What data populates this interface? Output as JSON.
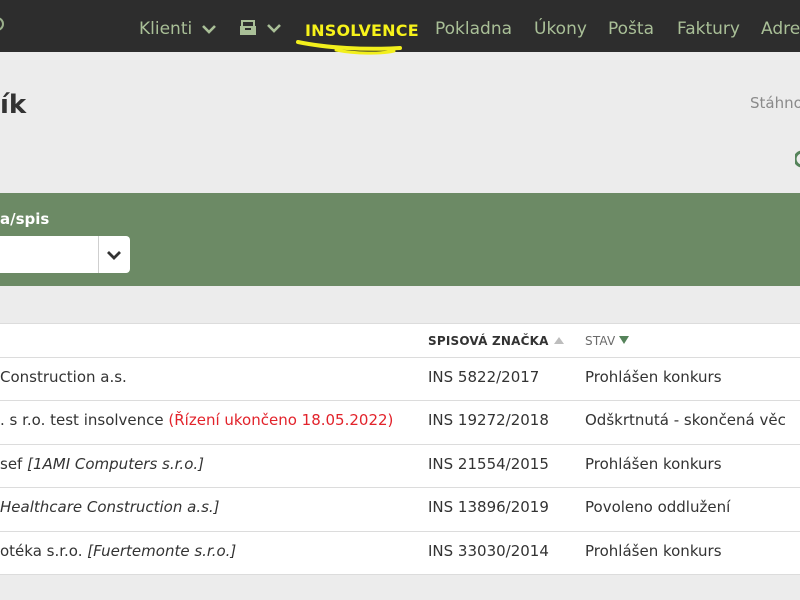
{
  "nav": {
    "items": [
      {
        "label": "Klienti"
      },
      {
        "label": "INSOLVENCE"
      },
      {
        "label": "Pokladna"
      },
      {
        "label": "Úkony"
      },
      {
        "label": "Pošta"
      },
      {
        "label": "Faktury"
      },
      {
        "label": "Adre"
      }
    ],
    "active_color": "#f6f21a",
    "icons": [
      "chevron-down-icon",
      "inbox-tray-icon",
      "chevron-down-icon"
    ]
  },
  "page": {
    "title": "ík",
    "download": "Stáhno"
  },
  "filter": {
    "label": "a/spis",
    "select_value": ""
  },
  "table": {
    "columns": [
      {
        "label": "SPISOVÁ ZNAČKA",
        "sort": "asc-inactive"
      },
      {
        "label": "STAV",
        "sort": "desc-active"
      }
    ],
    "rows": [
      {
        "name": "Construction a.s.",
        "name_extra": "",
        "note": "",
        "file_no": "INS 5822/2017",
        "state": "Prohlášen konkurs"
      },
      {
        "name": ". s r.o. test insolvence",
        "name_extra": "",
        "note": "(Řízení ukončeno 18.05.2022)",
        "file_no": "INS 19272/2018",
        "state": "Odškrtnutá - skončená věc"
      },
      {
        "name": "sef",
        "name_extra": "[1AMI Computers s.r.o.]",
        "note": "",
        "file_no": "INS 21554/2015",
        "state": "Prohlášen konkurs"
      },
      {
        "name": "",
        "name_extra": "Healthcare Construction a.s.]",
        "note": "",
        "file_no": "INS 13896/2019",
        "state": "Povoleno oddlužení"
      },
      {
        "name": "otéka s.r.o.",
        "name_extra": "[Fuertemonte s.r.o.]",
        "note": "",
        "file_no": "INS 33030/2014",
        "state": "Prohlášen konkurs"
      }
    ]
  },
  "colors": {
    "nav_bg": "#2d2d2d",
    "nav_text": "#a9bf97",
    "panel_green": "#6c8a65",
    "warning_red": "#e2232b"
  }
}
